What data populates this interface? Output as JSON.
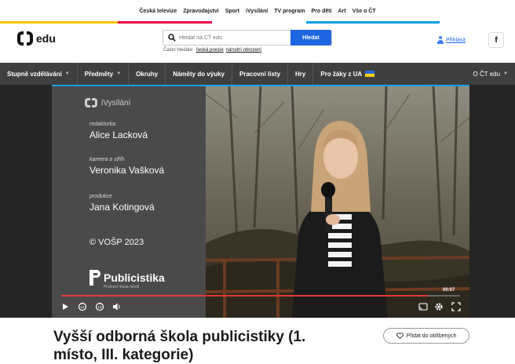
{
  "topbar": {
    "links": [
      "Česká televize",
      "Zpravodajství",
      "Sport",
      "iVysílání",
      "TV program",
      "Pro děti",
      "Art",
      "Vše o ČT"
    ]
  },
  "brand": {
    "logo_text": "edu"
  },
  "search": {
    "placeholder": "Hledat na ČT edu",
    "button_label": "Hledat",
    "quick_label": "Často hledáte:",
    "quick_links": [
      "česká poezie",
      "národní obrození"
    ]
  },
  "account": {
    "login_label": "Přihlásit",
    "facebook_label": "f"
  },
  "nav": {
    "items": [
      {
        "label": "Stupně vzdělávání",
        "dropdown": true
      },
      {
        "label": "Předměty",
        "dropdown": true
      },
      {
        "label": "Okruhy",
        "dropdown": false
      },
      {
        "label": "Náměty do výuky",
        "dropdown": false
      },
      {
        "label": "Pracovní listy",
        "dropdown": false
      },
      {
        "label": "Hry",
        "dropdown": false
      },
      {
        "label": "Pro žáky z UA",
        "dropdown": false
      }
    ],
    "about_label": "O ČT edu"
  },
  "video": {
    "channel": "iVysílání",
    "credits": [
      {
        "role": "redaktorka",
        "name": "Alice Lacková"
      },
      {
        "role": "kamera a střih",
        "name": "Veronika Vašková"
      },
      {
        "role": "produkce",
        "name": "Jana Kotingová"
      }
    ],
    "copyright": "© VOŠP 2023",
    "school_name": "Publicistika",
    "school_sub": "Profesní škola médií",
    "timecode": "00:07",
    "progress": 0.92
  },
  "page": {
    "title": "Vyšší odborná škola publicistiky (1. místo, III. kategorie)",
    "favorite_label": "Přidat do oblíbených"
  },
  "colors": {
    "nav_bg": "#3f3f3f",
    "accent_blue": "#1e67e0",
    "progress_red": "#e53935",
    "strip": [
      "#f5c400",
      "#e8004c",
      "#ffffff",
      "#00a0e3",
      "#ffffff"
    ]
  }
}
